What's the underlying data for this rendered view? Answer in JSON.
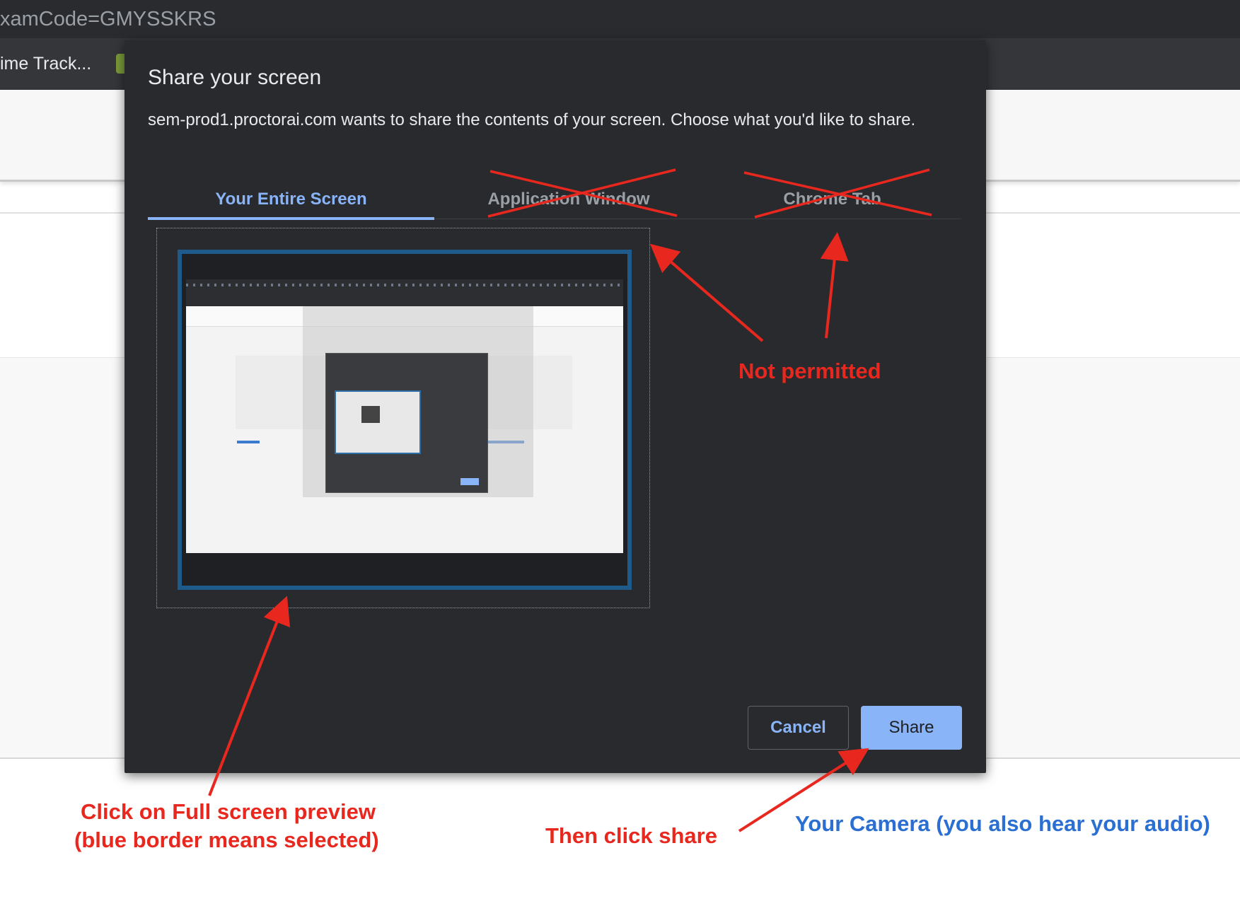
{
  "browser": {
    "url_fragment": "xamCode=GMYSSKRS",
    "bookmark_label": "ime Track..."
  },
  "dialog": {
    "title": "Share your screen",
    "description": "sem-prod1.proctorai.com wants to share the contents of your screen. Choose what you'd like to share.",
    "tabs": [
      {
        "label": "Your Entire Screen",
        "active": true
      },
      {
        "label": "Application Window",
        "active": false
      },
      {
        "label": "Chrome Tab",
        "active": false
      }
    ],
    "cancel_label": "Cancel",
    "share_label": "Share"
  },
  "annotations": {
    "not_permitted": "Not permitted",
    "click_preview_line1": "Click on Full screen preview",
    "click_preview_line2": "(blue border means selected)",
    "then_click_share": "Then click share",
    "camera_note": "Your Camera (you also hear your audio)",
    "colors": {
      "annotation": "#e8281e",
      "camera_note": "#2a6fd1",
      "accent": "#8ab4f8",
      "selection_border": "#1e5a8a"
    }
  }
}
